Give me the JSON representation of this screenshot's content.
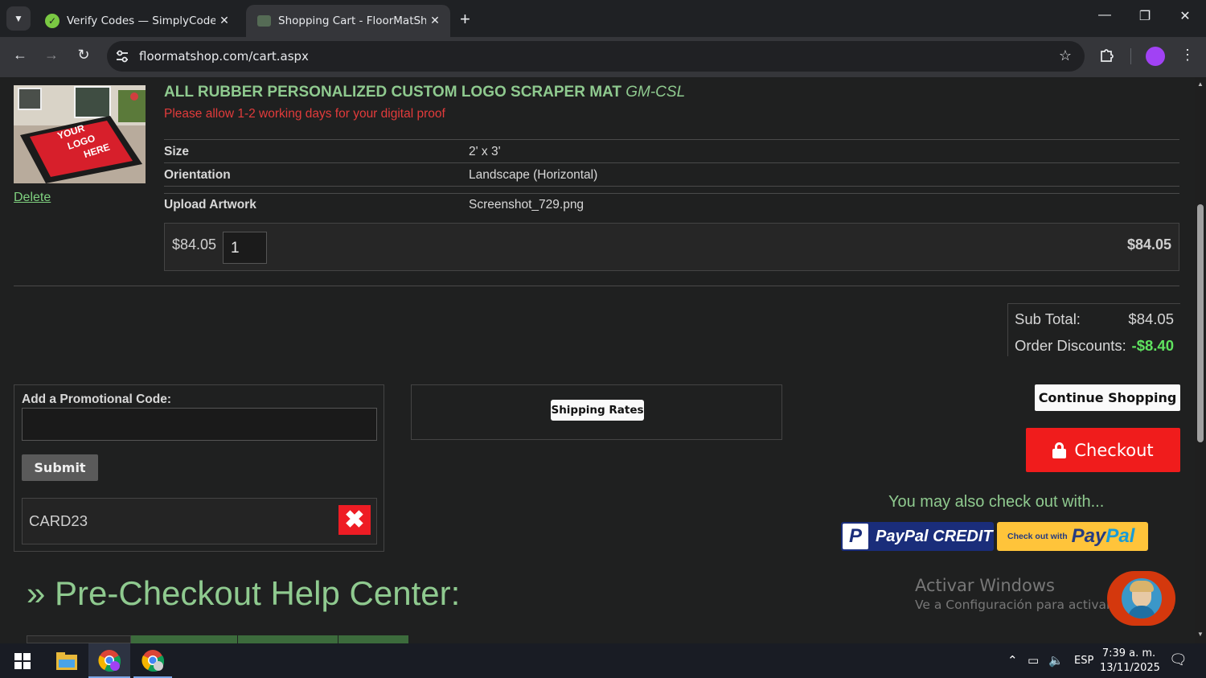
{
  "browser": {
    "tabs": [
      {
        "title": "Verify Codes — SimplyCodes",
        "active": false
      },
      {
        "title": "Shopping Cart - FloorMatShop",
        "active": true
      }
    ],
    "url": "floormatshop.com/cart.aspx"
  },
  "product": {
    "image_text": [
      "YOUR",
      "LOGO",
      "HERE"
    ],
    "title": "ALL RUBBER PERSONALIZED CUSTOM LOGO SCRAPER MAT",
    "sku": "GM-CSL",
    "note": "Please allow 1-2 working days for your digital proof",
    "delete_label": "Delete",
    "options": [
      {
        "label": "Size",
        "value": "2' x 3'"
      },
      {
        "label": "Orientation",
        "value": "Landscape (Horizontal)"
      },
      {
        "label": "Upload Artwork",
        "value": "Screenshot_729.png"
      }
    ],
    "unit_price": "$84.05",
    "quantity": "1",
    "line_total": "$84.05"
  },
  "totals": {
    "subtotal_label": "Sub Total:",
    "subtotal_value": "$84.05",
    "discount_label": "Order Discounts:",
    "discount_value": "-$8.40"
  },
  "promo": {
    "title": "Add a Promotional Code:",
    "input_value": "",
    "submit_label": "Submit",
    "applied_code": "CARD23",
    "remove_glyph": "✖"
  },
  "shipping": {
    "button_label": "Shipping Rates"
  },
  "actions": {
    "continue_label": "Continue Shopping",
    "checkout_label": "Checkout",
    "also_checkout": "You may also check out with...",
    "paypal_credit_label": "PayPal CREDIT",
    "paypal_small": "Check out with",
    "paypal_word1": "Pay",
    "paypal_word2": "Pal"
  },
  "help": {
    "title": "» Pre-Checkout Help Center:"
  },
  "watermark": {
    "line1": "Activar Windows",
    "line2": "Ve a Configuración para activar Windows."
  },
  "taskbar": {
    "language": "ESP",
    "time": "7:39 a. m.",
    "date": "13/11/2025"
  },
  "colors": {
    "accent_green": "#8fca8f",
    "checkout_red": "#f01c1c",
    "discount_green": "#5fe35f",
    "note_red": "#e23b3b"
  }
}
